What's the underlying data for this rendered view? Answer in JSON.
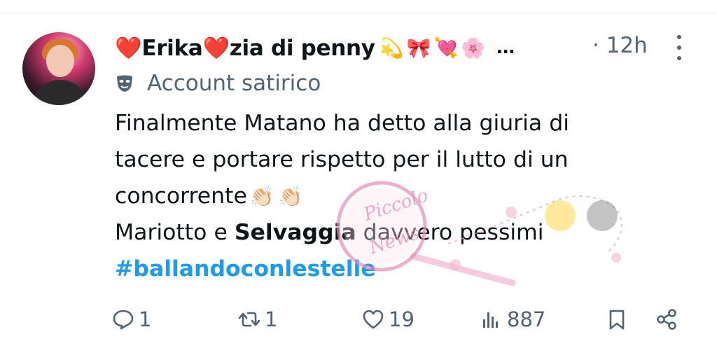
{
  "author": {
    "heart_left": "❤️",
    "name_a": "Erika",
    "heart_mid": "❤️",
    "name_b": "zia di penny",
    "emojis": "💫🎀💘🌸",
    "ellipsis": "…",
    "time": "· 12h"
  },
  "account_label": "Account satirico",
  "tweet": {
    "line1": "Finalmente Matano ha detto alla giuria di",
    "line2": "tacere e portare rispetto per il lutto di un",
    "line3": "concorrente",
    "claps": "👏🏻👏🏻",
    "line4_a": "Mariotto e ",
    "line4_bold": "Selvaggia",
    "line4_b": " davvero pessimi",
    "hashtag": "#ballandoconlestelle"
  },
  "watermark": {
    "line1": "Piccolo",
    "line2": "News"
  },
  "actions": {
    "reply_count": "1",
    "retweet_count": "1",
    "like_count": "19",
    "views_count": "887"
  },
  "colors": {
    "text": "#0f1419",
    "muted": "#536471",
    "hashtag": "#1d9bf0",
    "watermark": "#e58fb7"
  },
  "icons": [
    "avatar",
    "mask-icon",
    "more-icon",
    "reply-icon",
    "retweet-icon",
    "like-icon",
    "views-icon",
    "bookmark-icon",
    "share-icon"
  ]
}
